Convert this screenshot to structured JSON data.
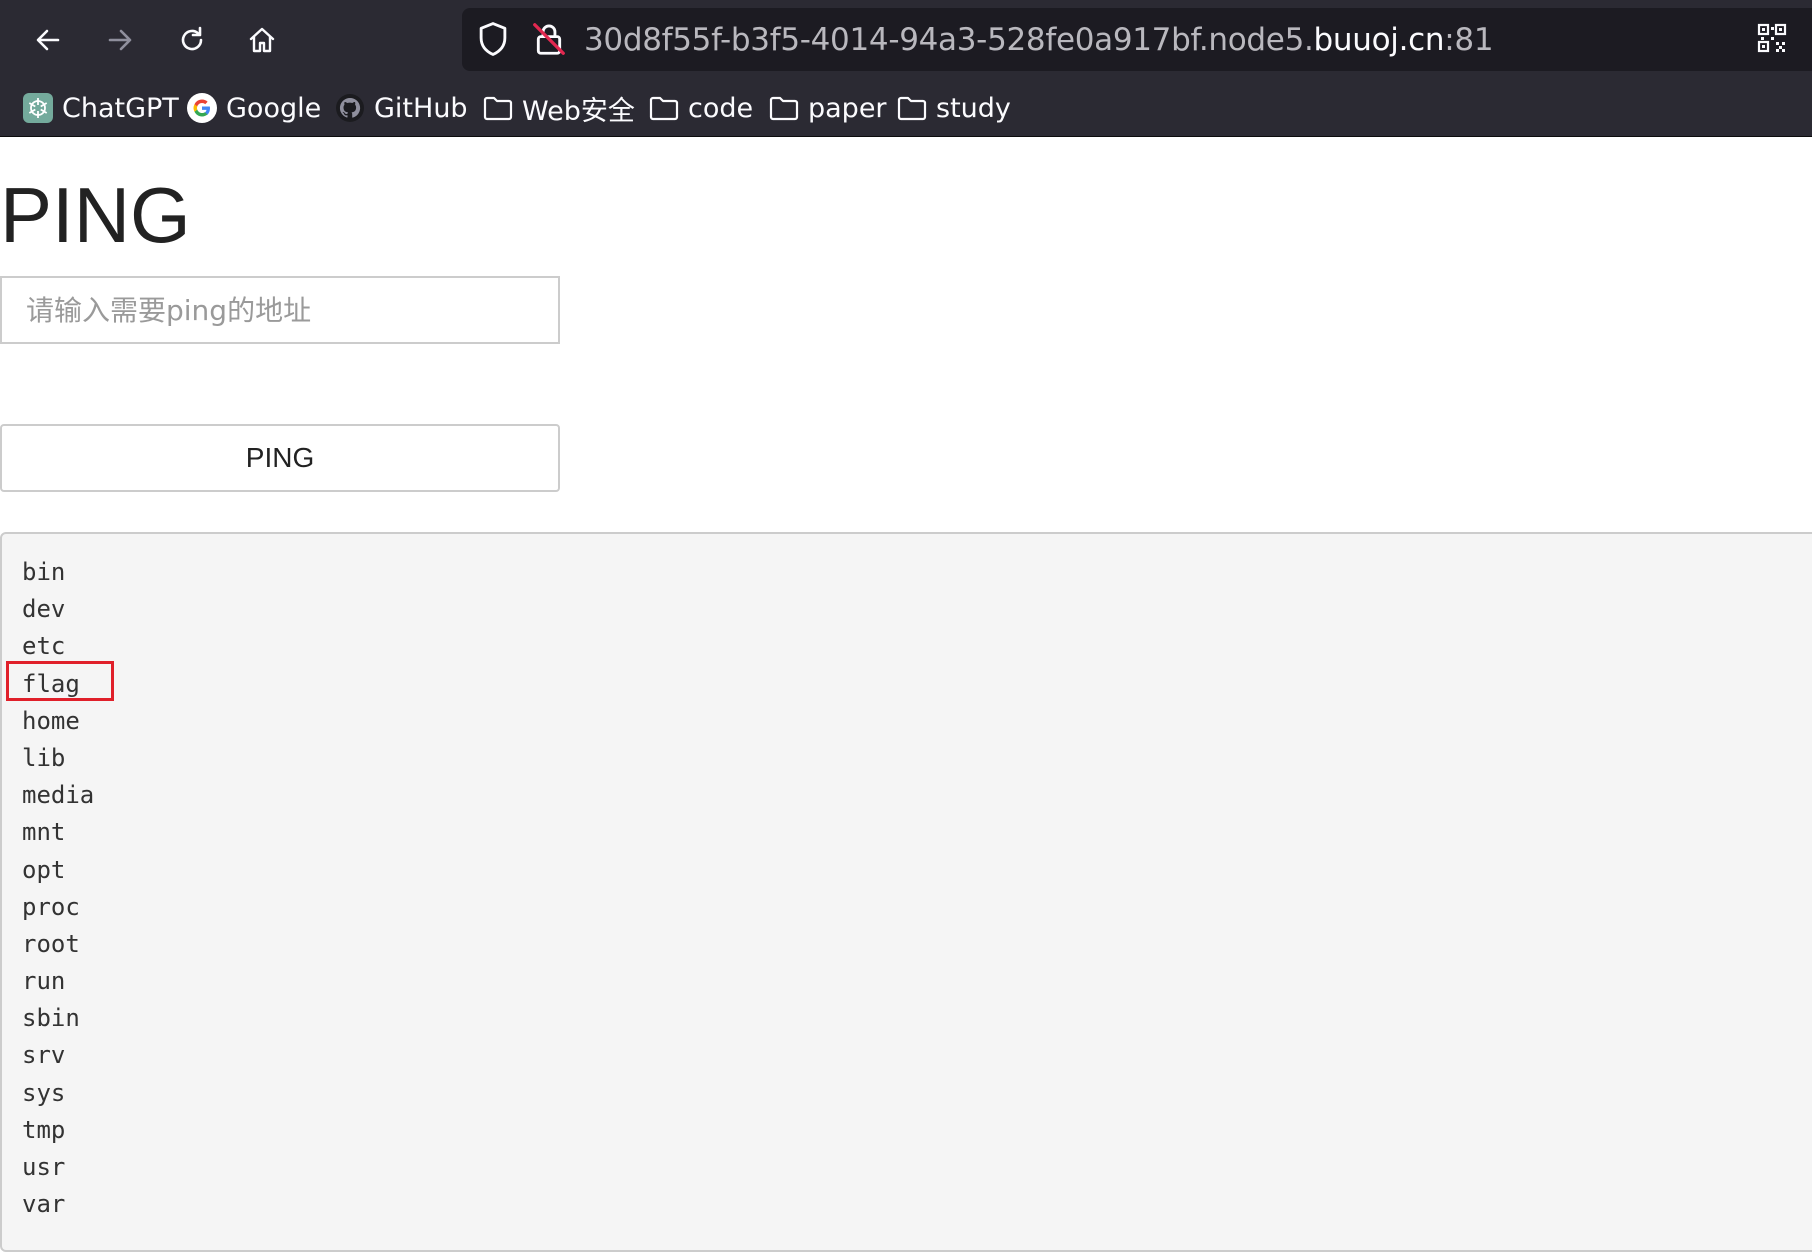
{
  "browser": {
    "url_prefix": "30d8f55f-b3f5-4014-94a3-528fe0a917bf.node5.",
    "url_domain": "buuoj.cn",
    "url_port": ":81",
    "icons": [
      "back-icon",
      "forward-icon",
      "reload-icon",
      "home-icon",
      "shield-icon",
      "insecure-lock-icon",
      "qr-code-icon"
    ]
  },
  "bookmarks": [
    {
      "label": "ChatGPT",
      "icon": "chatgpt-icon"
    },
    {
      "label": "Google",
      "icon": "google-icon"
    },
    {
      "label": "GitHub",
      "icon": "github-icon"
    },
    {
      "label": "Web安全",
      "icon": "folder-icon"
    },
    {
      "label": "code",
      "icon": "folder-icon"
    },
    {
      "label": "paper",
      "icon": "folder-icon"
    },
    {
      "label": "study",
      "icon": "folder-icon"
    }
  ],
  "page": {
    "title": "PING",
    "input_placeholder": "请输入需要ping的地址",
    "button_label": "PING"
  },
  "output": {
    "lines": [
      "bin",
      "dev",
      "etc",
      "flag",
      "home",
      "lib",
      "media",
      "mnt",
      "opt",
      "proc",
      "root",
      "run",
      "sbin",
      "srv",
      "sys",
      "tmp",
      "usr",
      "var"
    ],
    "highlighted_line": "flag",
    "highlight_color": "#e0202a"
  }
}
